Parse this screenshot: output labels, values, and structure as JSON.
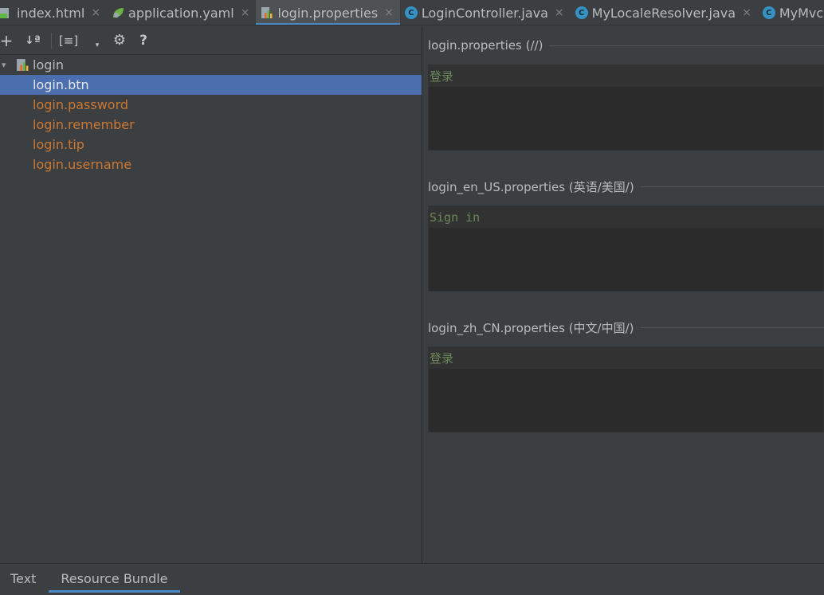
{
  "tabs": [
    {
      "label": "index.html",
      "icon": "html-file-icon",
      "active": false
    },
    {
      "label": "application.yaml",
      "icon": "spring-yaml-icon",
      "active": false
    },
    {
      "label": "login.properties",
      "icon": "properties-bundle-icon",
      "active": true
    },
    {
      "label": "LoginController.java",
      "icon": "java-class-icon",
      "active": false
    },
    {
      "label": "MyLocaleResolver.java",
      "icon": "java-class-icon",
      "active": false
    },
    {
      "label": "MyMvc",
      "icon": "java-class-icon",
      "active": false
    }
  ],
  "tab_close_glyph": "×",
  "class_icon_letter": "C",
  "toolbar": {
    "add_glyph": "+",
    "sort_glyph": "↓ª",
    "group_glyph": "[≡]",
    "dropdown_glyph": "▾",
    "settings_glyph": "⚙",
    "help_glyph": "?"
  },
  "tree": {
    "root_arrow": "▾",
    "root_label": "login",
    "keys": [
      "login.btn",
      "login.password",
      "login.remember",
      "login.tip",
      "login.username"
    ],
    "selected_index": 0
  },
  "sections": [
    {
      "title": "login.properties (//)",
      "value": "登录",
      "mono": false
    },
    {
      "title": "login_en_US.properties (英语/美国/)",
      "value": "Sign in",
      "mono": true
    },
    {
      "title": "login_zh_CN.properties (中文/中国/)",
      "value": "登录",
      "mono": false
    }
  ],
  "bottom_tabs": {
    "text_label": "Text",
    "resource_bundle_label": "Resource Bundle"
  },
  "colors": {
    "accent": "#4a88c7",
    "selection": "#4b6eaf",
    "key_orange": "#cc7832",
    "value_green": "#6a8759"
  }
}
